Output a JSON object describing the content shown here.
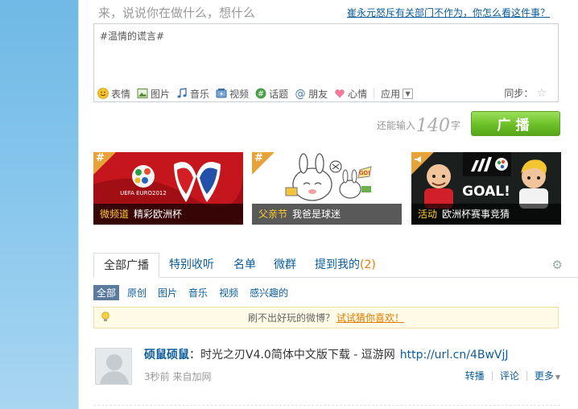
{
  "header": {
    "prompt": "来，说说你在做什么，想什么",
    "topic_link": "崔永元怒斥有关部门不作为，你怎么看这件事？"
  },
  "composer": {
    "text": "#温情的谎言#",
    "tools": [
      {
        "label": "表情",
        "icon": "smiley-icon"
      },
      {
        "label": "图片",
        "icon": "image-icon"
      },
      {
        "label": "音乐",
        "icon": "music-icon"
      },
      {
        "label": "视频",
        "icon": "video-icon"
      },
      {
        "label": "话题",
        "icon": "topic-icon"
      },
      {
        "label": "朋友",
        "icon": "at-icon"
      },
      {
        "label": "心情",
        "icon": "heart-icon"
      }
    ],
    "app_label": "应用",
    "sync_label": "同步："
  },
  "counter": {
    "prefix": "还能输入",
    "number": "140",
    "suffix": "字"
  },
  "broadcast_button": "广播",
  "banners": [
    {
      "category": "微频道",
      "title": "精彩欧洲杯",
      "bg": "#c4161c"
    },
    {
      "category": "父亲节",
      "title": "我爸是球迷",
      "bg": "#ffffff"
    },
    {
      "category": "活动",
      "title": "欧洲杯赛事竞猜",
      "bg": "#1b1f1e"
    }
  ],
  "banner_art": {
    "euro_text": "UEFA EURO2012",
    "goal_text": "GOAL!",
    "go_text": "GO!"
  },
  "tabs": [
    {
      "label": "全部广播"
    },
    {
      "label": "特别收听"
    },
    {
      "label": "名单"
    },
    {
      "label": "微群"
    },
    {
      "label": "提到我的",
      "badge": "(2)"
    }
  ],
  "filters": [
    "全部",
    "原创",
    "图片",
    "音乐",
    "视频",
    "感兴趣的"
  ],
  "notice": {
    "text": "刷不出好玩的微博？",
    "link": "试试猜你喜欢！"
  },
  "feed": {
    "user": "硕鼠硕鼠",
    "colon": "：",
    "content": "时光之刃V4.0简体中文版下载 - 逗游网",
    "url": "http://url.cn/4BwVjJ",
    "time": "3秒前",
    "source": "来自加网",
    "actions": {
      "repost": "转播",
      "comment": "评论",
      "more": "更多"
    }
  },
  "colors": {
    "link": "#0a5c9c",
    "accent_green": "#6cc026",
    "badge_orange": "#e07b00"
  }
}
